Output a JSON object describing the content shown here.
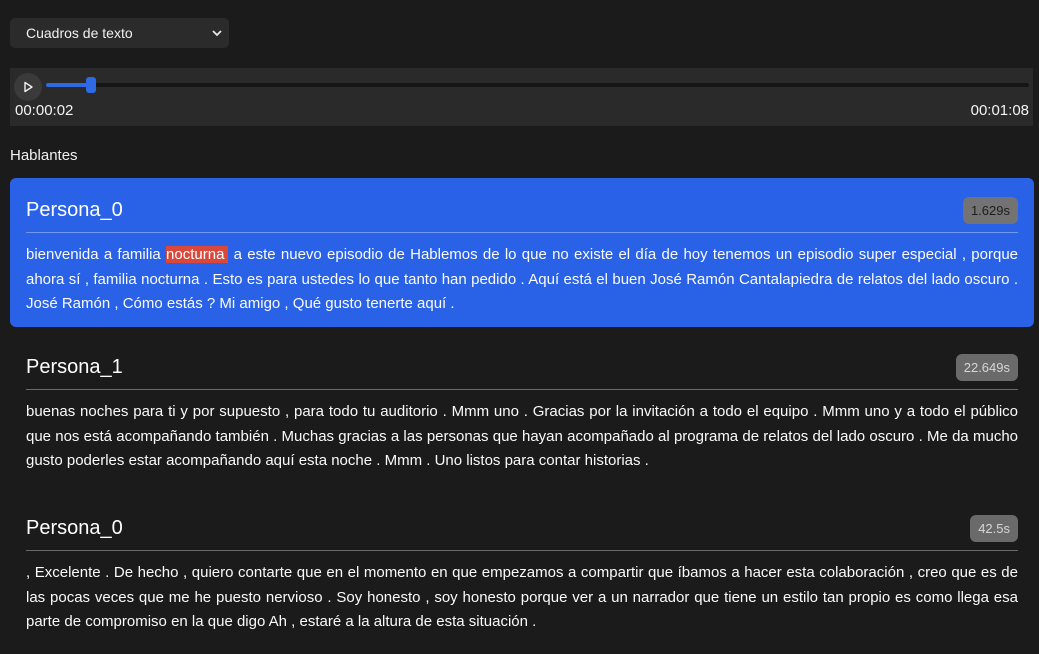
{
  "view_select": {
    "value": "Cuadros de texto"
  },
  "player": {
    "current_time": "00:00:02",
    "total_time": "00:01:08",
    "progress": 0.046
  },
  "speakers_label": "Hablantes",
  "segments": [
    {
      "speaker": "Persona_0",
      "duration": "1.629s",
      "active": true,
      "text_before": "bienvenida a familia ",
      "highlight": "nocturna",
      "text_after": " a este nuevo episodio de Hablemos de lo que no existe el día de hoy tenemos un episodio super especial , porque ahora sí , familia nocturna . Esto es para ustedes lo que tanto han pedido . Aquí está el buen José Ramón Cantalapiedra de relatos del lado oscuro . José Ramón , Cómo estás ? Mi amigo , Qué gusto tenerte aquí ."
    },
    {
      "speaker": "Persona_1",
      "duration": "22.649s",
      "active": false,
      "text": "buenas noches para ti y por supuesto , para todo tu auditorio . Mmm uno . Gracias por la invitación a todo el equipo . Mmm uno y a todo el público que nos está acompañando también . Muchas gracias a las personas que hayan acompañado al programa de relatos del lado oscuro . Me da mucho gusto poderles estar acompañando aquí esta noche . Mmm . Uno listos para contar historias ."
    },
    {
      "speaker": "Persona_0",
      "duration": "42.5s",
      "active": false,
      "text": ", Excelente . De hecho , quiero contarte que en el momento en que empezamos a compartir que íbamos a hacer esta colaboración , creo que es de las pocas veces que me he puesto nervioso . Soy honesto , soy honesto porque ver a un narrador que tiene un estilo tan propio es como llega esa parte de compromiso en la que digo Ah , estaré a la altura de esta situación ."
    }
  ]
}
